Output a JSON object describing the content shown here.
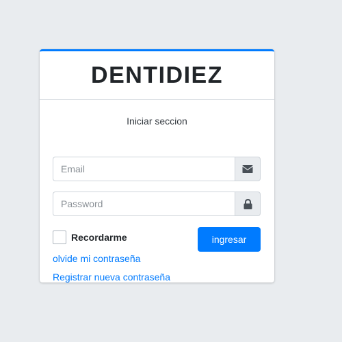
{
  "brand": {
    "title": "DENTIDIEZ"
  },
  "login": {
    "subtitle": "Iniciar seccion",
    "email": {
      "placeholder": "Email",
      "value": "",
      "icon": "envelope-icon"
    },
    "password": {
      "placeholder": "Password",
      "value": "",
      "icon": "lock-icon"
    },
    "remember": {
      "label": "Recordarme",
      "checked": false
    },
    "submit_label": "ingresar",
    "forgot_link": "olvide mi contraseña",
    "register_link": "Registrar nueva contraseña"
  },
  "colors": {
    "accent": "#007bff",
    "background": "#e9ecef",
    "card": "#ffffff",
    "text": "#212529"
  }
}
